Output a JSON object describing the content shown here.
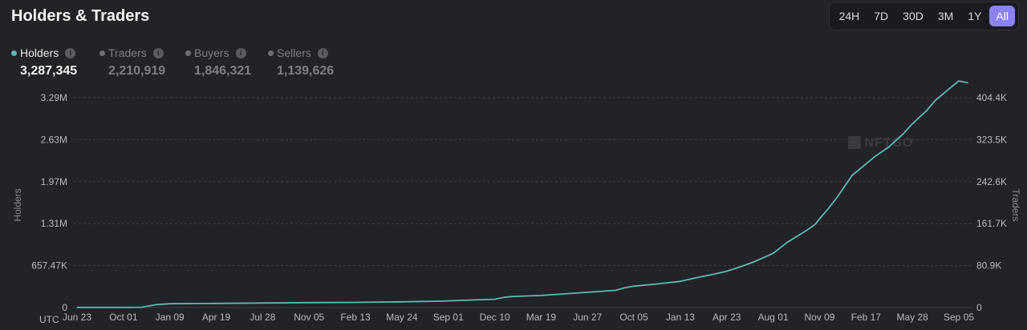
{
  "header": {
    "title": "Holders & Traders"
  },
  "ranges": [
    {
      "label": "24H",
      "active": false
    },
    {
      "label": "7D",
      "active": false
    },
    {
      "label": "30D",
      "active": false
    },
    {
      "label": "3M",
      "active": false
    },
    {
      "label": "1Y",
      "active": false
    },
    {
      "label": "All",
      "active": true
    }
  ],
  "legend": [
    {
      "label": "Holders",
      "value": "3,287,345",
      "color": "#5fb8b0",
      "active": true
    },
    {
      "label": "Traders",
      "value": "2,210,919",
      "color": "#6e6f75",
      "active": false
    },
    {
      "label": "Buyers",
      "value": "1,846,321",
      "color": "#6e6f75",
      "active": false
    },
    {
      "label": "Sellers",
      "value": "1,139,626",
      "color": "#6e6f75",
      "active": false
    }
  ],
  "watermark": "NFTGO",
  "chart_data": {
    "type": "line",
    "x_axis_label": "UTC",
    "xlabel_ticks": [
      "Jun 23",
      "Oct 01",
      "Jan 09",
      "Apr 19",
      "Jul 28",
      "Nov 05",
      "Feb 13",
      "May 24",
      "Sep 01",
      "Dec 10",
      "Mar 19",
      "Jun 27",
      "Oct 05",
      "Jan 13",
      "Apr 23",
      "Aug 01",
      "Nov 09",
      "Feb 17",
      "May 28",
      "Sep 05"
    ],
    "ylabel_left": "Holders",
    "ylabel_right": "Traders",
    "y_left_ticks": [
      "0",
      "657.47K",
      "1.31M",
      "1.97M",
      "2.63M",
      "3.29M"
    ],
    "y_right_ticks": [
      "0",
      "80.9K",
      "161.7K",
      "242.6K",
      "323.5K",
      "404.4K"
    ],
    "ylim_left": [
      0,
      3287345
    ],
    "grid": true,
    "series": [
      {
        "name": "Holders",
        "color": "#5fb8b0",
        "x_index": [
          0,
          1,
          1.4,
          1.7,
          2,
          3,
          4,
          5,
          6,
          7,
          7.8,
          8,
          8.6,
          9,
          9.2,
          9.4,
          10,
          10.6,
          11,
          11.6,
          11.8,
          12,
          12.5,
          13,
          13.3,
          13.7,
          14,
          14.3,
          14.6,
          15,
          15.3,
          15.5,
          15.7,
          15.9,
          16,
          16.2,
          16.4,
          16.7,
          17,
          17.2,
          17.5,
          17.8,
          18,
          18.3,
          18.5,
          18.8,
          19,
          19.2
        ],
        "values": [
          2000,
          3000,
          5000,
          45000,
          60000,
          65000,
          72000,
          78000,
          82000,
          90000,
          100000,
          105000,
          120000,
          130000,
          160000,
          175000,
          190000,
          220000,
          240000,
          270000,
          310000,
          335000,
          370000,
          410000,
          460000,
          520000,
          570000,
          640000,
          720000,
          850000,
          1020000,
          1110000,
          1200000,
          1300000,
          1390000,
          1560000,
          1750000,
          2070000,
          2250000,
          2370000,
          2520000,
          2720000,
          2880000,
          3080000,
          3250000,
          3430000,
          3550000,
          3520000
        ]
      }
    ]
  }
}
